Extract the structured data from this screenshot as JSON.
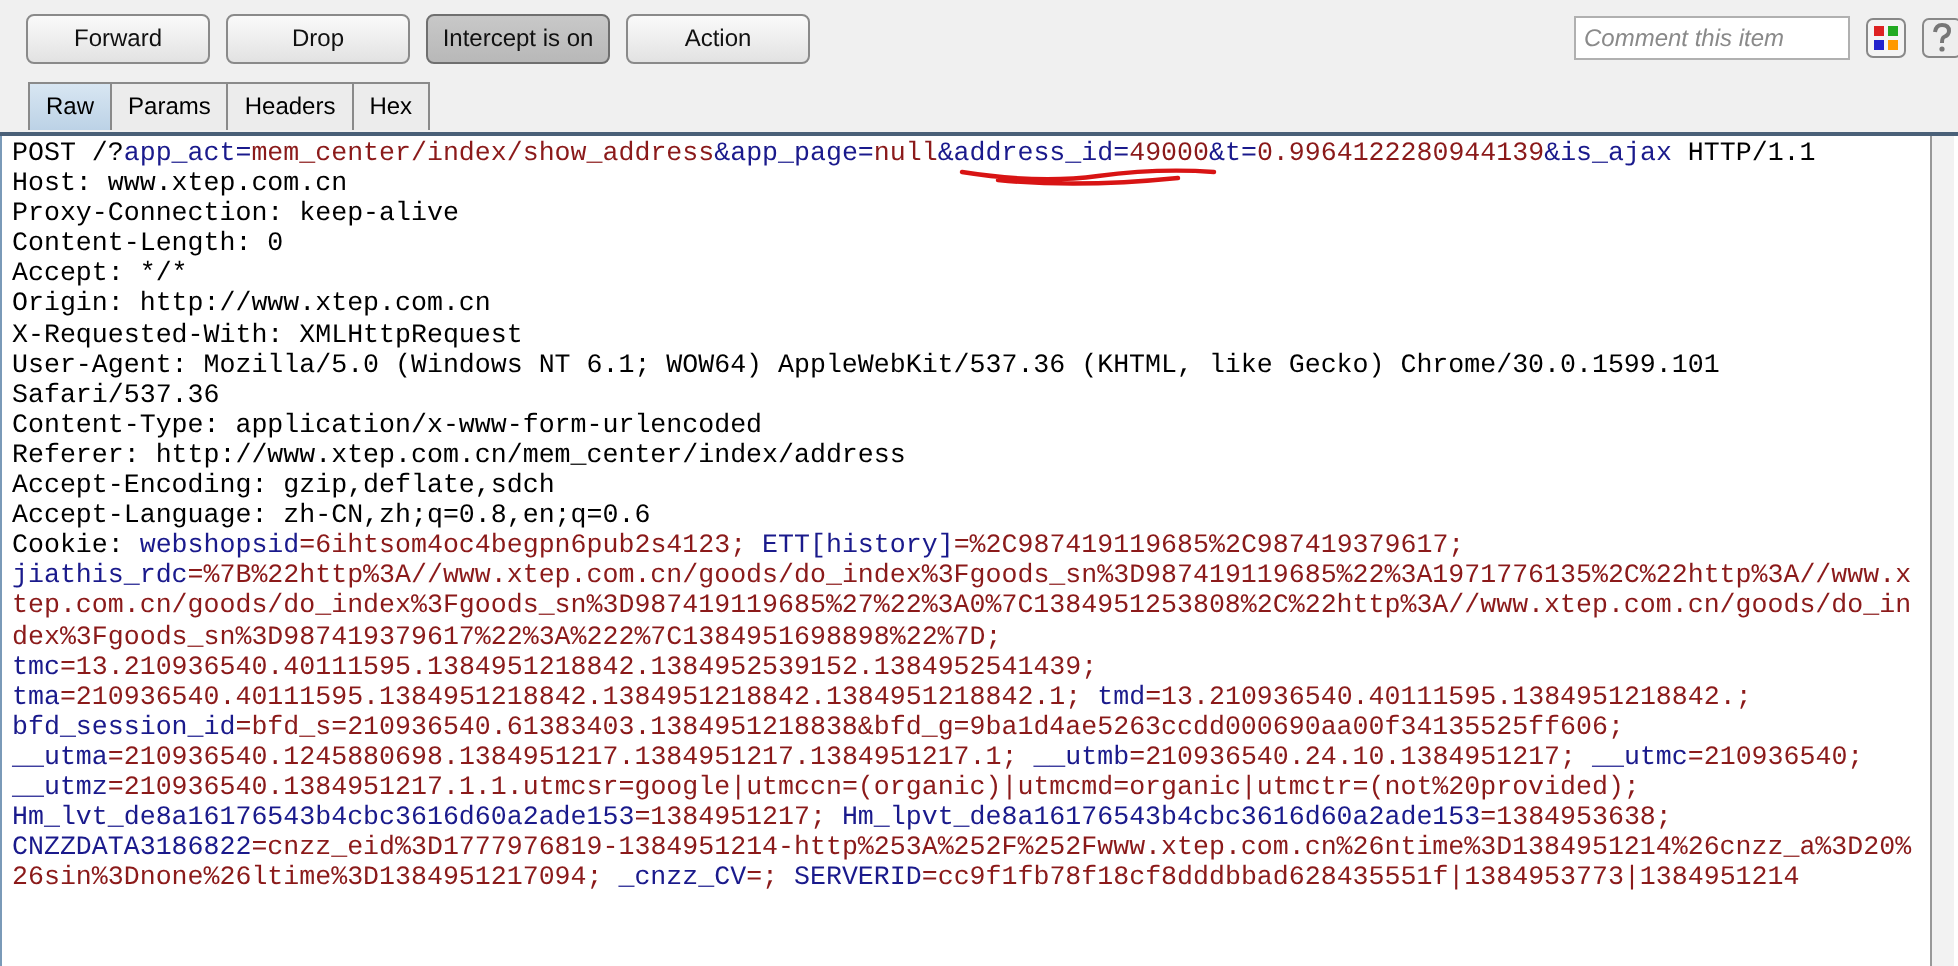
{
  "toolbar": {
    "buttons": [
      {
        "label": "Forward",
        "pressed": false
      },
      {
        "label": "Drop",
        "pressed": false
      },
      {
        "label": "Intercept is on",
        "pressed": true
      },
      {
        "label": "Action",
        "pressed": false
      }
    ],
    "comment": {
      "placeholder": "Comment this item"
    }
  },
  "tabs": [
    {
      "label": "Raw",
      "selected": true
    },
    {
      "label": "Params",
      "selected": false
    },
    {
      "label": "Headers",
      "selected": false
    },
    {
      "label": "Hex",
      "selected": false
    }
  ],
  "request_lines": [
    [
      {
        "kind": "plain",
        "text": "POST /?"
      },
      {
        "kind": "param",
        "text": "app_act="
      },
      {
        "kind": "value",
        "text": "mem_center/index/show_address"
      },
      {
        "kind": "param",
        "text": "&app_page="
      },
      {
        "kind": "value",
        "text": "null"
      },
      {
        "kind": "param",
        "text": "&address_id="
      },
      {
        "kind": "value",
        "text": "49000"
      },
      {
        "kind": "param",
        "text": "&t="
      },
      {
        "kind": "value",
        "text": "0.9964122280944139"
      },
      {
        "kind": "param",
        "text": "&is_ajax"
      },
      {
        "kind": "plain",
        "text": " HTTP/1.1"
      }
    ],
    [
      {
        "kind": "plain",
        "text": "Host: www.xtep.com.cn"
      }
    ],
    [
      {
        "kind": "plain",
        "text": "Proxy-Connection: keep-alive"
      }
    ],
    [
      {
        "kind": "plain",
        "text": "Content-Length: 0"
      }
    ],
    [
      {
        "kind": "plain",
        "text": "Accept: */*"
      }
    ],
    [
      {
        "kind": "plain",
        "text": "Origin: http://www.xtep.com.cn"
      }
    ],
    [
      {
        "kind": "plain",
        "text": "X-Requested-With: XMLHttpRequest"
      }
    ],
    [
      {
        "kind": "plain",
        "text": "User-Agent: Mozilla/5.0 (Windows NT 6.1; WOW64) AppleWebKit/537.36 (KHTML, like Gecko) Chrome/30.0.1599.101"
      }
    ],
    [
      {
        "kind": "plain",
        "text": "Safari/537.36"
      }
    ],
    [
      {
        "kind": "plain",
        "text": "Content-Type: application/x-www-form-urlencoded"
      }
    ],
    [
      {
        "kind": "plain",
        "text": "Referer: http://www.xtep.com.cn/mem_center/index/address"
      }
    ],
    [
      {
        "kind": "plain",
        "text": "Accept-Encoding: gzip,deflate,sdch"
      }
    ],
    [
      {
        "kind": "plain",
        "text": "Accept-Language: zh-CN,zh;q=0.8,en;q=0.6"
      }
    ],
    [
      {
        "kind": "plain",
        "text": "Cookie: "
      },
      {
        "kind": "param",
        "text": "webshopsid"
      },
      {
        "kind": "value",
        "text": "=6ihtsom4oc4begpn6pub2s4123; "
      },
      {
        "kind": "param",
        "text": "ETT[history]"
      },
      {
        "kind": "value",
        "text": "=%2C987419119685%2C987419379617;"
      }
    ],
    [
      {
        "kind": "param",
        "text": "jiathis_rdc"
      },
      {
        "kind": "value",
        "text": "=%7B%22http%3A//www.xtep.com.cn/goods/do_index%3Fgoods_sn%3D987419119685%22%3A1971776135%2C%22http%3A//www.x"
      }
    ],
    [
      {
        "kind": "value",
        "text": "tep.com.cn/goods/do_index%3Fgoods_sn%3D987419119685%27%22%3A0%7C1384951253808%2C%22http%3A//www.xtep.com.cn/goods/do_in"
      }
    ],
    [
      {
        "kind": "value",
        "text": "dex%3Fgoods_sn%3D987419379617%22%3A%222%7C1384951698898%22%7D;"
      }
    ],
    [
      {
        "kind": "param",
        "text": "tmc"
      },
      {
        "kind": "value",
        "text": "=13.210936540.40111595.1384951218842.1384952539152.1384952541439;"
      }
    ],
    [
      {
        "kind": "param",
        "text": "tma"
      },
      {
        "kind": "value",
        "text": "=210936540.40111595.1384951218842.1384951218842.1384951218842.1; "
      },
      {
        "kind": "param",
        "text": "tmd"
      },
      {
        "kind": "value",
        "text": "=13.210936540.40111595.1384951218842.;"
      }
    ],
    [
      {
        "kind": "param",
        "text": "bfd_session_id"
      },
      {
        "kind": "value",
        "text": "=bfd_s=210936540.61383403.1384951218838&bfd_g=9ba1d4ae5263ccdd000690aa00f34135525ff606;"
      }
    ],
    [
      {
        "kind": "param",
        "text": "__utma"
      },
      {
        "kind": "value",
        "text": "=210936540.1245880698.1384951217.1384951217.1384951217.1; "
      },
      {
        "kind": "param",
        "text": "__utmb"
      },
      {
        "kind": "value",
        "text": "=210936540.24.10.1384951217; "
      },
      {
        "kind": "param",
        "text": "__utmc"
      },
      {
        "kind": "value",
        "text": "=210936540;"
      }
    ],
    [
      {
        "kind": "param",
        "text": "__utmz"
      },
      {
        "kind": "value",
        "text": "=210936540.1384951217.1.1.utmcsr=google|utmccn=(organic)|utmcmd=organic|utmctr=(not%20provided);"
      }
    ],
    [
      {
        "kind": "param",
        "text": "Hm_lvt_de8a16176543b4cbc3616d60a2ade153"
      },
      {
        "kind": "value",
        "text": "=1384951217; "
      },
      {
        "kind": "param",
        "text": "Hm_lpvt_de8a16176543b4cbc3616d60a2ade153"
      },
      {
        "kind": "value",
        "text": "=1384953638;"
      }
    ],
    [
      {
        "kind": "param",
        "text": "CNZZDATA3186822"
      },
      {
        "kind": "value",
        "text": "=cnzz_eid%3D1777976819-1384951214-http%253A%252F%252Fwww.xtep.com.cn%26ntime%3D1384951214%26cnzz_a%3D20%"
      }
    ],
    [
      {
        "kind": "value",
        "text": "26sin%3Dnone%26ltime%3D1384951217094; "
      },
      {
        "kind": "param",
        "text": "_cnzz_CV"
      },
      {
        "kind": "value",
        "text": "=; "
      },
      {
        "kind": "param",
        "text": "SERVERID"
      },
      {
        "kind": "value",
        "text": "=cc9f1fb78f18cf8dddbbad628435551f|1384953773|1384951214"
      }
    ]
  ]
}
